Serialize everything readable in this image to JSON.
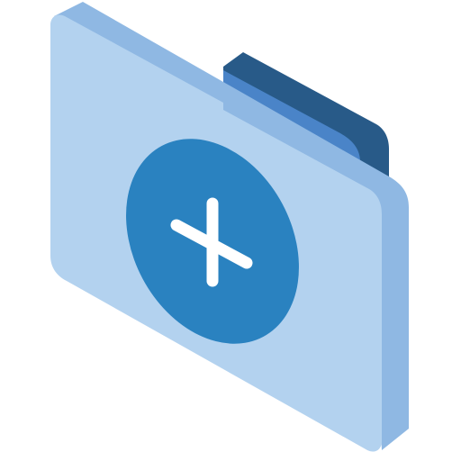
{
  "icon": {
    "name": "add-folder-icon",
    "colors": {
      "background": "#ffffff",
      "folder_front": "#b3d2ef",
      "folder_side": "#8fb8e3",
      "tab_front": "#4a84c8",
      "tab_top": "#285a88",
      "plus_circle": "#2a82c0",
      "plus_sign": "#ffffff"
    }
  }
}
